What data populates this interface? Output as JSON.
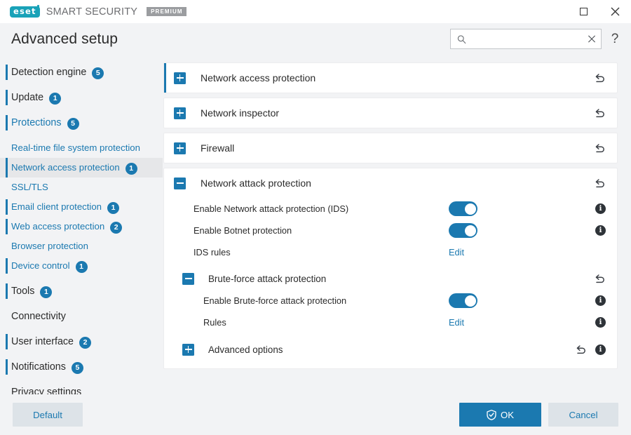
{
  "window": {
    "product_name": "SMART SECURITY",
    "logo_text": "eset",
    "edition_badge": "PREMIUM",
    "maximize_title": "Maximize",
    "close_title": "Close"
  },
  "header": {
    "title": "Advanced setup",
    "search": {
      "value": "",
      "placeholder": ""
    },
    "clear_label": "✕",
    "help_label": "?"
  },
  "sidebar": {
    "items": [
      {
        "label": "Detection engine",
        "badge": "5",
        "level": "top",
        "bar": true,
        "accent": false,
        "selected": false
      },
      {
        "label": "Update",
        "badge": "1",
        "level": "top",
        "bar": true,
        "accent": false,
        "selected": false
      },
      {
        "label": "Protections",
        "badge": "5",
        "level": "top",
        "bar": true,
        "accent": true,
        "selected": false
      },
      {
        "label": "Real-time file system protection",
        "badge": "",
        "level": "sub",
        "bar": false,
        "accent": false,
        "selected": false
      },
      {
        "label": "Network access protection",
        "badge": "1",
        "level": "sub",
        "bar": true,
        "accent": false,
        "selected": true
      },
      {
        "label": "SSL/TLS",
        "badge": "",
        "level": "sub",
        "bar": false,
        "accent": false,
        "selected": false
      },
      {
        "label": "Email client protection",
        "badge": "1",
        "level": "sub",
        "bar": true,
        "accent": false,
        "selected": false
      },
      {
        "label": "Web access protection",
        "badge": "2",
        "level": "sub",
        "bar": true,
        "accent": false,
        "selected": false
      },
      {
        "label": "Browser protection",
        "badge": "",
        "level": "sub",
        "bar": false,
        "accent": false,
        "selected": false
      },
      {
        "label": "Device control",
        "badge": "1",
        "level": "sub",
        "bar": true,
        "accent": false,
        "selected": false
      },
      {
        "label": "Tools",
        "badge": "1",
        "level": "top",
        "bar": true,
        "accent": false,
        "selected": false
      },
      {
        "label": "Connectivity",
        "badge": "",
        "level": "top",
        "bar": false,
        "accent": false,
        "selected": false
      },
      {
        "label": "User interface",
        "badge": "2",
        "level": "top",
        "bar": true,
        "accent": false,
        "selected": false
      },
      {
        "label": "Notifications",
        "badge": "5",
        "level": "top",
        "bar": true,
        "accent": false,
        "selected": false
      },
      {
        "label": "Privacy settings",
        "badge": "",
        "level": "top",
        "bar": false,
        "accent": false,
        "selected": false
      }
    ]
  },
  "main": {
    "cards": [
      {
        "title": "Network access protection",
        "expanded": false,
        "focused": true
      },
      {
        "title": "Network inspector",
        "expanded": false,
        "focused": false
      },
      {
        "title": "Firewall",
        "expanded": false,
        "focused": false
      }
    ],
    "expanded_card": {
      "title": "Network attack protection",
      "rows": [
        {
          "label": "Enable Network attack protection (IDS)",
          "control": "toggle",
          "value": "on",
          "info": true
        },
        {
          "label": "Enable Botnet protection",
          "control": "toggle",
          "value": "on",
          "info": true
        },
        {
          "label": "IDS rules",
          "control": "link",
          "value": "Edit",
          "info": false
        }
      ],
      "subsection": {
        "title": "Brute-force attack protection",
        "expanded": true,
        "rows": [
          {
            "label": "Enable Brute-force attack protection",
            "control": "toggle",
            "value": "on",
            "info": true
          },
          {
            "label": "Rules",
            "control": "link",
            "value": "Edit",
            "info": true
          }
        ]
      },
      "advanced": {
        "title": "Advanced options",
        "expanded": false
      }
    }
  },
  "footer": {
    "default_label": "Default",
    "ok_label": "OK",
    "cancel_label": "Cancel"
  },
  "colors": {
    "accent": "#1b79b0",
    "logo_teal": "#19a2b8",
    "page_bg": "#f2f3f5",
    "card_bg": "#ffffff",
    "info_dark": "#2e3338"
  }
}
